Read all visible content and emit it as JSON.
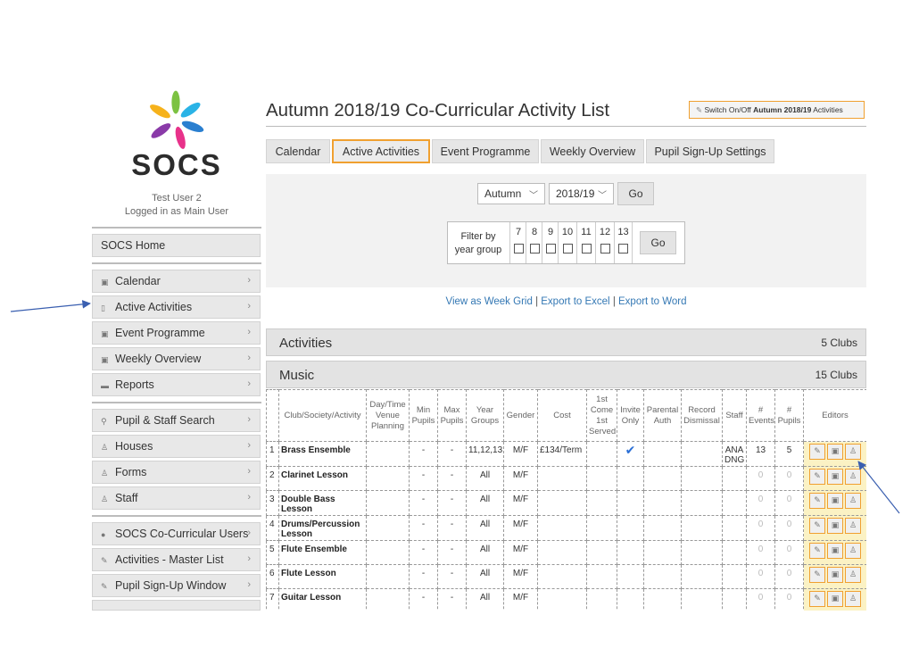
{
  "brand": "SOCS",
  "user": {
    "name": "Test User 2",
    "role": "Logged in as Main User"
  },
  "sidebar": {
    "home": "SOCS Home",
    "group1": [
      {
        "label": "Calendar",
        "icon": "calendar-icon"
      },
      {
        "label": "Active Activities",
        "icon": "clipboard-icon"
      },
      {
        "label": "Event Programme",
        "icon": "calendar-icon"
      },
      {
        "label": "Weekly Overview",
        "icon": "calendar-icon"
      },
      {
        "label": "Reports",
        "icon": "folder-icon"
      }
    ],
    "group2": [
      {
        "label": "Pupil & Staff Search",
        "icon": "search-icon"
      },
      {
        "label": "Houses",
        "icon": "person-icon"
      },
      {
        "label": "Forms",
        "icon": "person-icon"
      },
      {
        "label": "Staff",
        "icon": "person-icon"
      }
    ],
    "group3": [
      {
        "label": "SOCS Co-Curricular Users",
        "icon": "lock-icon"
      },
      {
        "label": "Activities - Master List",
        "icon": "wrench-icon"
      },
      {
        "label": "Pupil Sign-Up Window",
        "icon": "wrench-icon"
      }
    ]
  },
  "page": {
    "title": "Autumn 2018/19 Co-Curricular Activity List",
    "switch": {
      "prefix": "Switch On/Off",
      "term": "Autumn 2018/19",
      "suffix": "Activities"
    }
  },
  "tabs": [
    "Calendar",
    "Active Activities",
    "Event Programme",
    "Weekly Overview",
    "Pupil Sign-Up Settings"
  ],
  "active_tab": "Active Activities",
  "filters": {
    "term": "Autumn",
    "year": "2018/19",
    "go": "Go",
    "filter_label_1": "Filter by",
    "filter_label_2": "year group",
    "years": [
      "7",
      "8",
      "9",
      "10",
      "11",
      "12",
      "13"
    ]
  },
  "links": {
    "week_grid": "View as Week Grid",
    "excel": "Export to Excel",
    "word": "Export to Word",
    "sep": "|"
  },
  "sections": {
    "activities": {
      "label": "Activities",
      "count": "5 Clubs"
    },
    "music": {
      "label": "Music",
      "count": "15 Clubs"
    }
  },
  "table": {
    "headers": [
      "",
      "Club/Society/Activity",
      "Day/Time Venue Planning",
      "Min Pupils",
      "Max Pupils",
      "Year Groups",
      "Gender",
      "Cost",
      "1st Come 1st Served",
      "Invite Only",
      "Parental Auth",
      "Record Dismissal",
      "Staff",
      "# Events",
      "# Pupils",
      "Editors"
    ],
    "rows": [
      {
        "n": "1",
        "name": "Brass Ensemble",
        "min": "-",
        "max": "-",
        "years": "11,12,13",
        "gender": "M/F",
        "cost": "£134/Term",
        "invite": "✔",
        "staff": "ANA DNG",
        "events": "13",
        "pupils": "5"
      },
      {
        "n": "2",
        "name": "Clarinet Lesson",
        "min": "-",
        "max": "-",
        "years": "All",
        "gender": "M/F",
        "cost": "",
        "invite": "",
        "staff": "",
        "events": "0",
        "pupils": "0"
      },
      {
        "n": "3",
        "name": "Double Bass Lesson",
        "min": "-",
        "max": "-",
        "years": "All",
        "gender": "M/F",
        "cost": "",
        "invite": "",
        "staff": "",
        "events": "0",
        "pupils": "0"
      },
      {
        "n": "4",
        "name": "Drums/Percussion Lesson",
        "min": "-",
        "max": "-",
        "years": "All",
        "gender": "M/F",
        "cost": "",
        "invite": "",
        "staff": "",
        "events": "0",
        "pupils": "0"
      },
      {
        "n": "5",
        "name": "Flute Ensemble",
        "min": "-",
        "max": "-",
        "years": "All",
        "gender": "M/F",
        "cost": "",
        "invite": "",
        "staff": "",
        "events": "0",
        "pupils": "0"
      },
      {
        "n": "6",
        "name": "Flute Lesson",
        "min": "-",
        "max": "-",
        "years": "All",
        "gender": "M/F",
        "cost": "",
        "invite": "",
        "staff": "",
        "events": "0",
        "pupils": "0"
      },
      {
        "n": "7",
        "name": "Guitar Lesson",
        "min": "-",
        "max": "-",
        "years": "All",
        "gender": "M/F",
        "cost": "",
        "invite": "",
        "staff": "",
        "events": "0",
        "pupils": "0"
      }
    ]
  },
  "colors": {
    "accent": "#f0a030",
    "link": "#3478b4",
    "annotation": "#3a5fb0",
    "tick": "#2a6fd6"
  }
}
